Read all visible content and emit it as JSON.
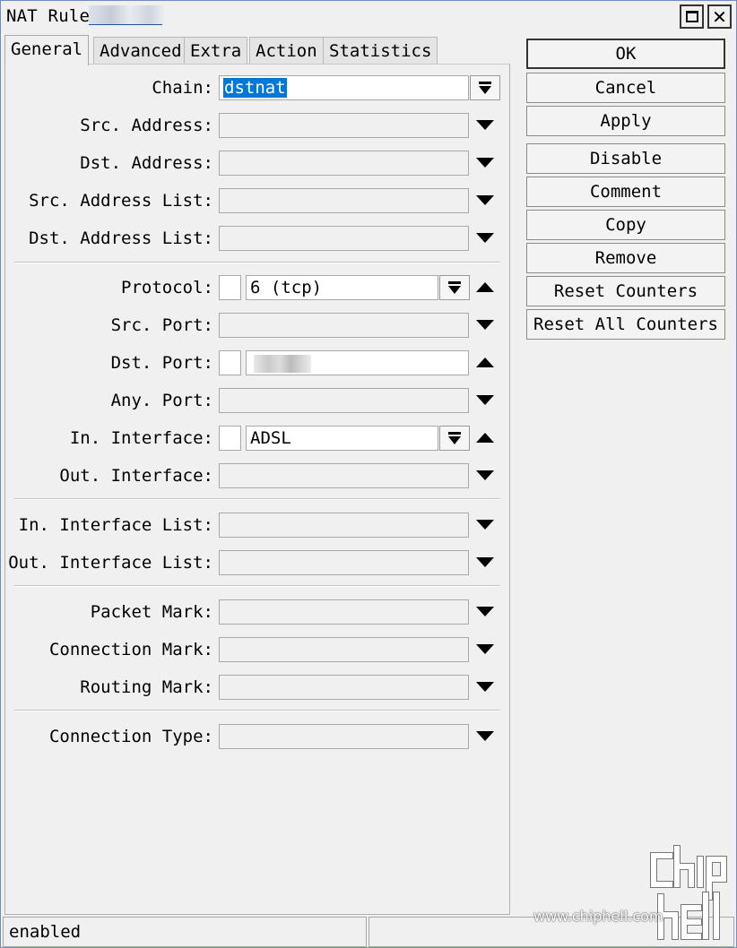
{
  "window": {
    "title": "NAT Rule"
  },
  "tabs": [
    {
      "label": "General",
      "active": true
    },
    {
      "label": "Advanced",
      "active": false
    },
    {
      "label": "Extra",
      "active": false
    },
    {
      "label": "Action",
      "active": false
    },
    {
      "label": "Statistics",
      "active": false
    }
  ],
  "form": {
    "chain": {
      "label": "Chain:",
      "value": "dstnat"
    },
    "src_address": {
      "label": "Src. Address:"
    },
    "dst_address": {
      "label": "Dst. Address:"
    },
    "src_address_list": {
      "label": "Src. Address List:"
    },
    "dst_address_list": {
      "label": "Dst. Address List:"
    },
    "protocol": {
      "label": "Protocol:",
      "value": "6 (tcp)"
    },
    "src_port": {
      "label": "Src. Port:"
    },
    "dst_port": {
      "label": "Dst. Port:"
    },
    "any_port": {
      "label": "Any. Port:"
    },
    "in_interface": {
      "label": "In. Interface:",
      "value": "ADSL"
    },
    "out_interface": {
      "label": "Out. Interface:"
    },
    "in_interface_list": {
      "label": "In. Interface List:"
    },
    "out_interface_list": {
      "label": "Out. Interface List:"
    },
    "packet_mark": {
      "label": "Packet Mark:"
    },
    "connection_mark": {
      "label": "Connection Mark:"
    },
    "routing_mark": {
      "label": "Routing Mark:"
    },
    "connection_type": {
      "label": "Connection Type:"
    }
  },
  "buttons": {
    "ok": "OK",
    "cancel": "Cancel",
    "apply": "Apply",
    "disable": "Disable",
    "comment": "Comment",
    "copy": "Copy",
    "remove": "Remove",
    "reset_counters": "Reset Counters",
    "reset_all_counters": "Reset All Counters"
  },
  "status": {
    "state": "enabled"
  },
  "watermark": {
    "text": "www.chiphell.com"
  },
  "colors": {
    "selection": "#0078d7",
    "window_border": "#6b8fc4",
    "background": "#f0f0f0"
  }
}
